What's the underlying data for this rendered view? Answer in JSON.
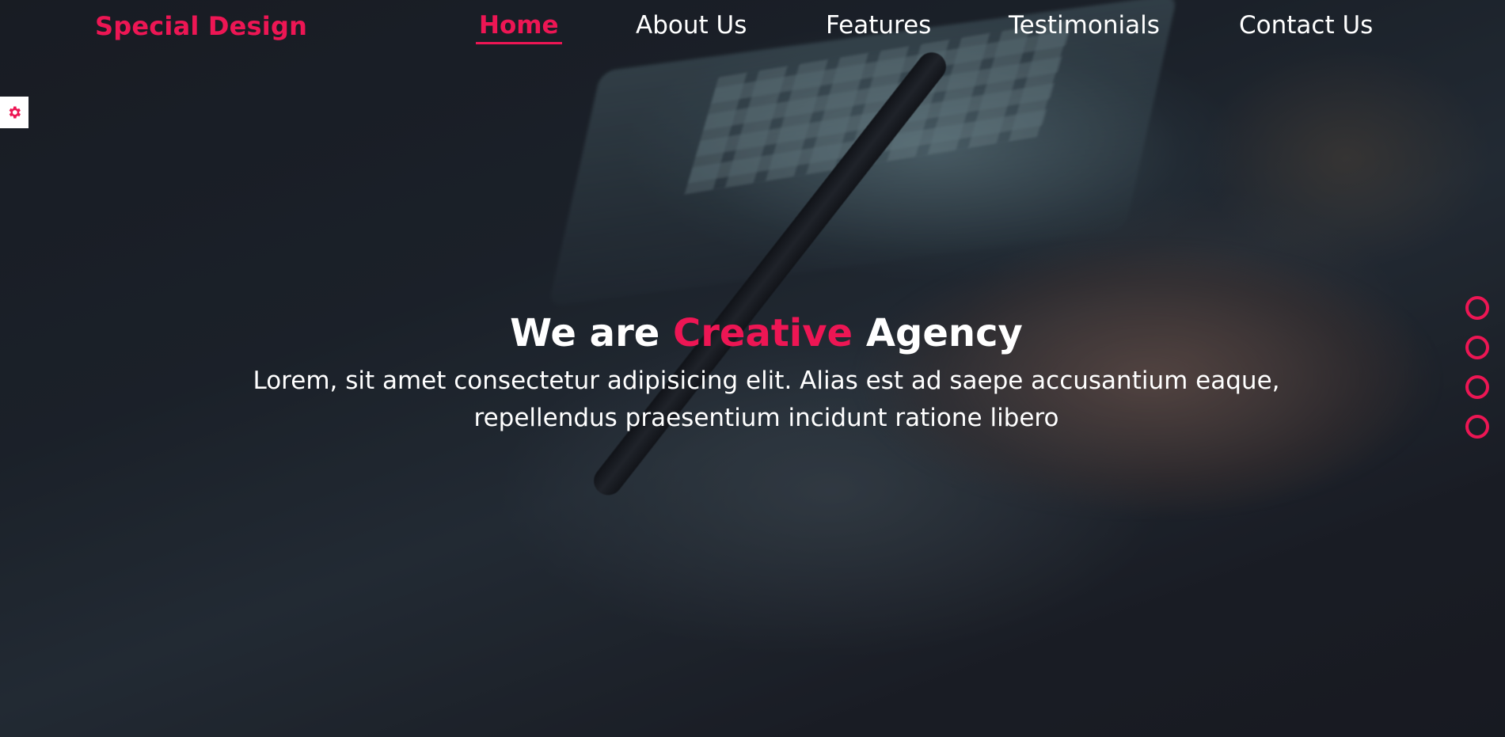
{
  "header": {
    "logo": "Special Design",
    "nav": [
      {
        "label": "Home",
        "active": true
      },
      {
        "label": "About Us",
        "active": false
      },
      {
        "label": "Features",
        "active": false
      },
      {
        "label": "Testimonials",
        "active": false
      },
      {
        "label": "Contact Us",
        "active": false
      }
    ]
  },
  "settings": {
    "icon": "gear-icon"
  },
  "hero": {
    "title_start": "We are",
    "title_accent": "Creative",
    "title_end": "Agency",
    "description": "Lorem, sit amet consectetur adipisicing elit. Alias est ad saepe accusantium eaque, repellendus praesentium incidunt ratione libero"
  },
  "bullets": [
    {
      "section": "About Us"
    },
    {
      "section": "Features"
    },
    {
      "section": "Testimonials"
    },
    {
      "section": "Contact Us"
    }
  ],
  "colors": {
    "accent": "#ed1654",
    "text": "#ffffff",
    "background": "#1b1f27"
  }
}
